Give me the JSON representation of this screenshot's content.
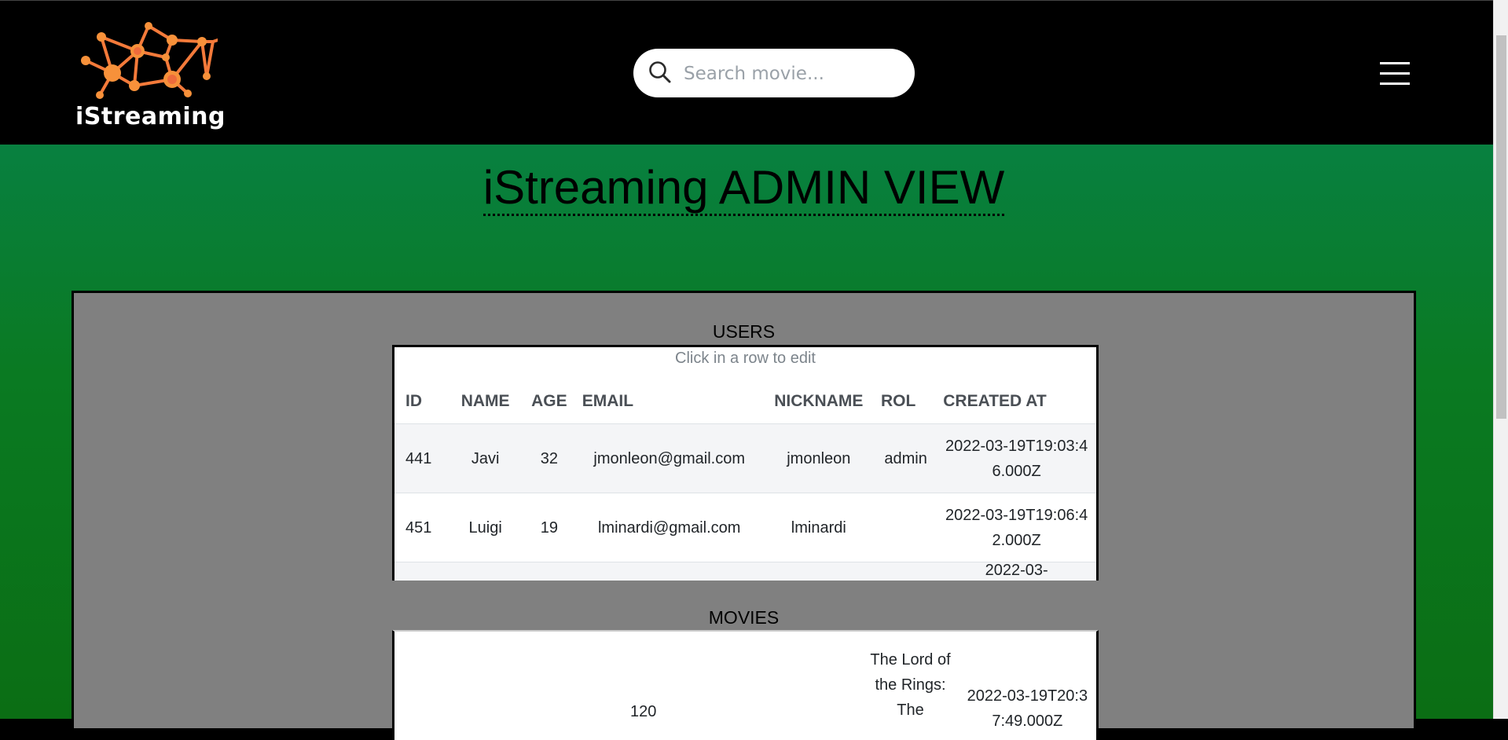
{
  "brand": {
    "name": "iStreaming"
  },
  "search": {
    "placeholder": "Search movie..."
  },
  "page": {
    "title": "iStreaming ADMIN VIEW"
  },
  "users": {
    "caption": "USERS",
    "hint": "Click in a row to edit",
    "columns": [
      "ID",
      "NAME",
      "AGE",
      "EMAIL",
      "NICKNAME",
      "ROL",
      "CREATED AT"
    ],
    "rows": [
      [
        "441",
        "Javi",
        "32",
        "jmonleon@gmail.com",
        "jmonleon",
        "admin",
        "2022-03-19T19:03:46.000Z"
      ],
      [
        "451",
        "Luigi",
        "19",
        "lminardi@gmail.com",
        "lminardi",
        "",
        "2022-03-19T19:06:42.000Z"
      ],
      [
        "",
        "",
        "",
        "",
        "",
        "",
        "2022-03-"
      ]
    ]
  },
  "movies": {
    "caption": "MOVIES",
    "rows": [
      [
        "",
        "",
        "120",
        "",
        "The Lord of the Rings: The",
        "2022-03-19T20:37:49.000Z"
      ]
    ]
  },
  "colors": {
    "header_bg": "#000000",
    "main_gradient_top": "#088040",
    "main_gradient_bottom": "#0b6e14",
    "panel_bg": "#808080",
    "logo_orange": "#f7913a"
  },
  "icons": {
    "search": "search-icon",
    "menu": "hamburger-menu-icon",
    "logo": "network-logo-icon"
  }
}
